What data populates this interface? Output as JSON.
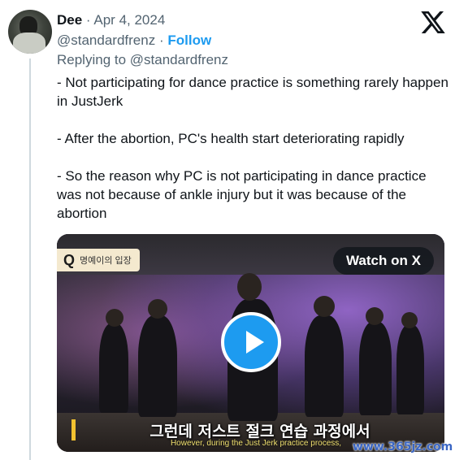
{
  "author": {
    "name": "Dee",
    "separator": "·",
    "date": "Apr 4, 2024",
    "handle": "@standardfrenz",
    "follow_label": "Follow",
    "avatar_icon": "profile-photo"
  },
  "reply": {
    "prefix": "Replying to",
    "handle": "@standardfrenz"
  },
  "platform_icon": "x-logo-icon",
  "body": [
    "- Not participating for dance practice is something rarely happen in JustJerk",
    "- After the abortion, PC's health start deteriorating rapidly",
    "- So the reason why PC is not participating in dance practice was not because of ankle injury but it was because of the abortion"
  ],
  "media": {
    "badge_letter": "Q",
    "badge_text": "명예이의 입장",
    "watch_label": "Watch on X",
    "play_icon": "play-icon",
    "caption_korean": "그런데 저스트 절크 연습 과정에서",
    "caption_english": "However, during the Just Jerk practice process,"
  },
  "watermark": "www.365jz.com",
  "colors": {
    "accent": "#1d9bf0",
    "text": "#0f1419",
    "muted": "#536471"
  }
}
